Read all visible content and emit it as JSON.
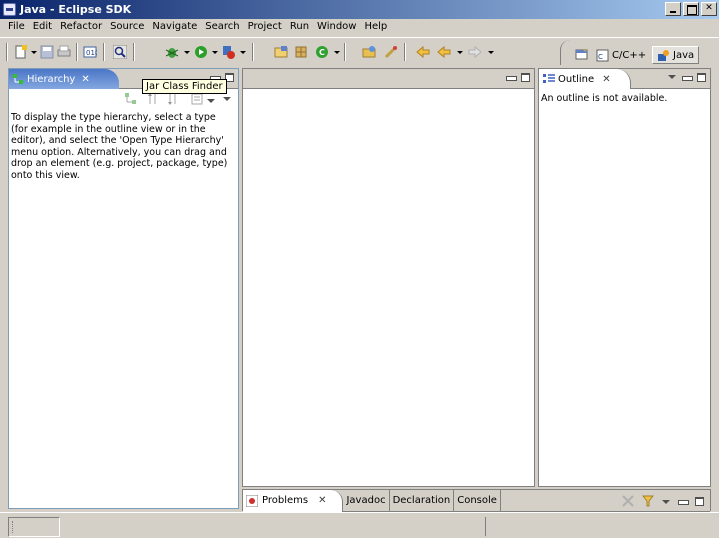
{
  "window": {
    "title": "Java - Eclipse SDK"
  },
  "menu": [
    "File",
    "Edit",
    "Refactor",
    "Source",
    "Navigate",
    "Search",
    "Project",
    "Run",
    "Window",
    "Help"
  ],
  "perspectives": {
    "cpp": "C/C++",
    "java": "Java"
  },
  "hierarchy_view": {
    "tab_label": "Hierarchy",
    "tooltip": "Jar Class Finder",
    "message": "To display the type hierarchy, select a type (for example in the outline view or in the editor), and select the 'Open Type Hierarchy' menu option. Alternatively, you can drag and drop an element (e.g. project, package, type) onto this view."
  },
  "outline_view": {
    "tab_label": "Outline",
    "message": "An outline is not available."
  },
  "bottom_tabs": [
    "Problems",
    "Javadoc",
    "Declaration",
    "Console"
  ],
  "colors": {
    "active_tab": "#4a76c6",
    "titlebar": "#0a246a",
    "chrome": "#d4d0c8"
  }
}
